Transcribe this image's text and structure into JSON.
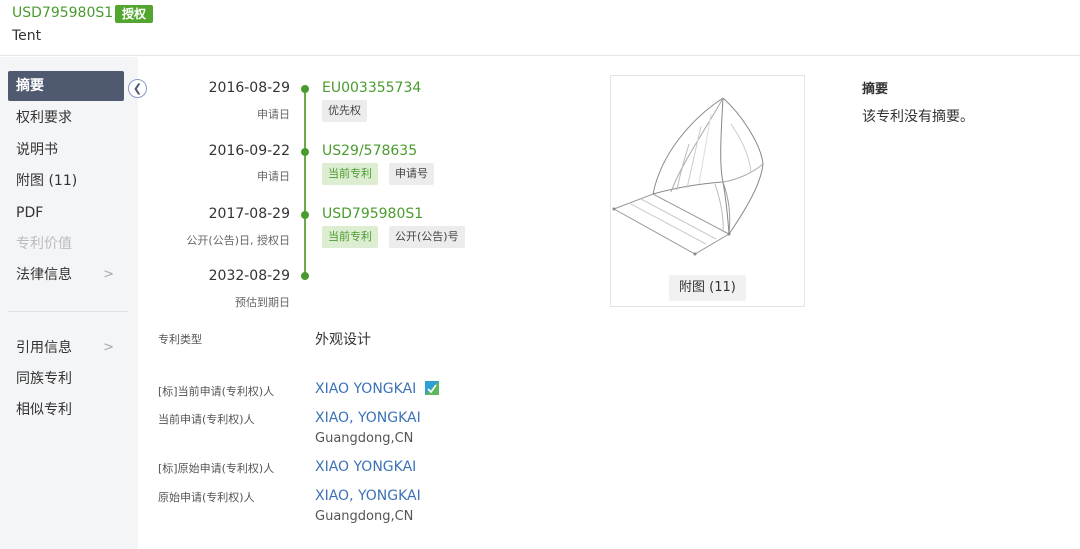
{
  "header": {
    "patent_no": "USD795980S1",
    "status_badge": "授权",
    "title": "Tent"
  },
  "sidebar": {
    "items": [
      {
        "label": "摘要",
        "active": true
      },
      {
        "label": "权利要求"
      },
      {
        "label": "说明书"
      },
      {
        "label": "附图 (11)"
      },
      {
        "label": "PDF"
      },
      {
        "label": "专利价值",
        "disabled": true
      },
      {
        "label": "法律信息",
        "arrow": ">"
      },
      {
        "label": "引用信息",
        "arrow": ">"
      },
      {
        "label": "同族专利"
      },
      {
        "label": "相似专利"
      }
    ],
    "collapse_icon": "chevron-left-icon"
  },
  "timeline": [
    {
      "date": "2016-08-29",
      "label": "申请日",
      "link": "EU003355734",
      "tags": [
        {
          "text": "优先权",
          "style": "gray"
        }
      ]
    },
    {
      "date": "2016-09-22",
      "label": "申请日",
      "link": "US29/578635",
      "tags": [
        {
          "text": "当前专利",
          "style": "green"
        },
        {
          "text": "申请号",
          "style": "gray"
        }
      ]
    },
    {
      "date": "2017-08-29",
      "label": "公开(公告)日, 授权日",
      "link": "USD795980S1",
      "tags": [
        {
          "text": "当前专利",
          "style": "green"
        },
        {
          "text": "公开(公告)号",
          "style": "gray"
        }
      ]
    },
    {
      "date": "2032-08-29",
      "label": "预估到期日"
    }
  ],
  "fields": {
    "patent_type_label": "专利类型",
    "patent_type_value": "外观设计",
    "std_current_applicant_label": "[标]当前申请(专利权)人",
    "std_current_applicant_value": "XIAO YONGKAI",
    "current_applicant_label": "当前申请(专利权)人",
    "current_applicant_value": "XIAO, YONGKAI",
    "current_applicant_location": "Guangdong,CN",
    "std_original_applicant_label": "[标]原始申请(专利权)人",
    "std_original_applicant_value": "XIAO YONGKAI",
    "original_applicant_label": "原始申请(专利权)人",
    "original_applicant_value": "XIAO, YONGKAI",
    "original_applicant_location": "Guangdong,CN"
  },
  "figure": {
    "caption": "附图 (11)"
  },
  "abstract": {
    "title": "摘要",
    "text": "该专利没有摘要。"
  },
  "colors": {
    "accent_green": "#4a9b2e",
    "link_blue": "#3c72b8",
    "sidebar_active": "#4f5a70"
  }
}
